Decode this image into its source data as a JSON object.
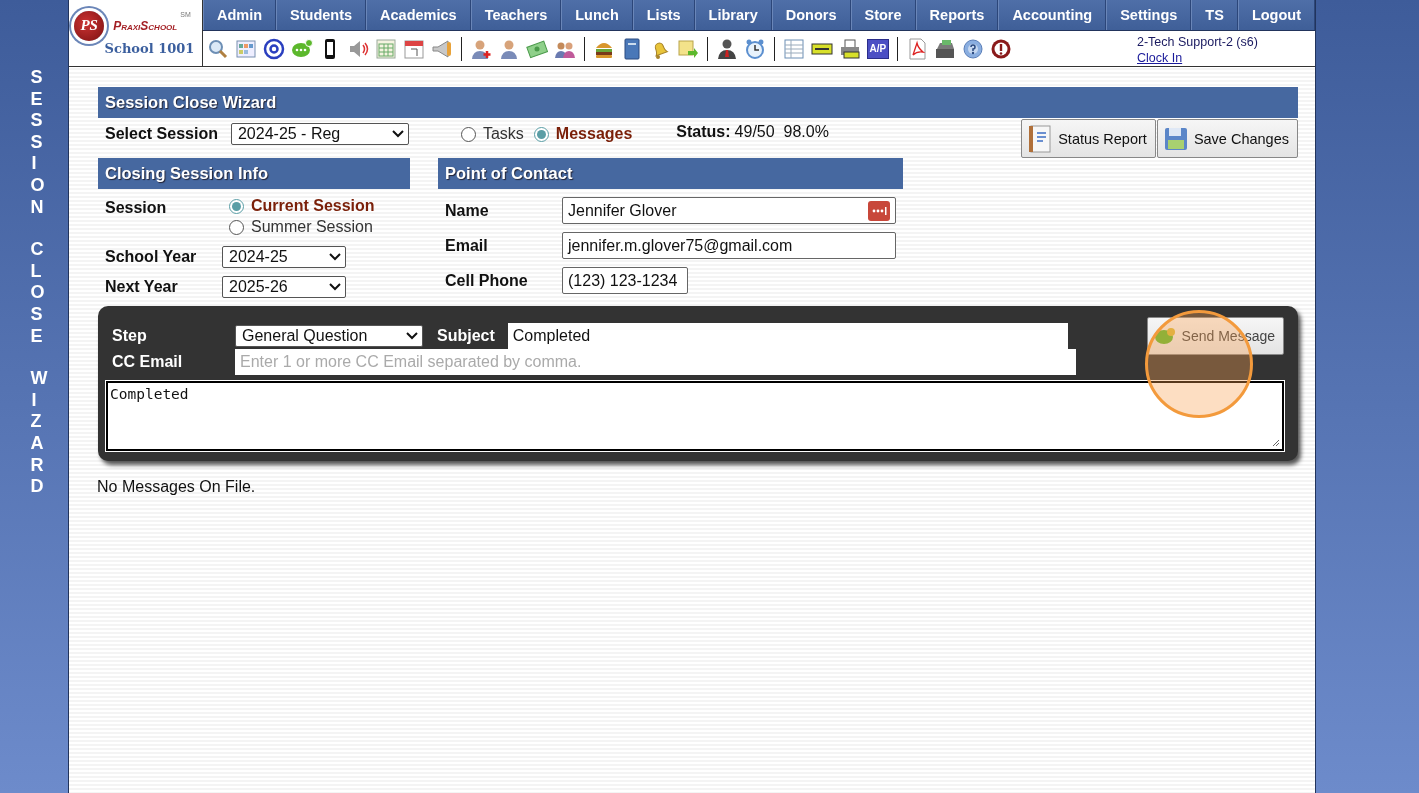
{
  "side_title": [
    "SESSION",
    "CLOSE",
    "WIZARD"
  ],
  "logo": {
    "mark": "PS",
    "brand": "PraxiSchool",
    "tm": "SM",
    "school": "School 1001"
  },
  "nav": [
    "Admin",
    "Students",
    "Academics",
    "Teachers",
    "Lunch",
    "Lists",
    "Library",
    "Donors",
    "Store",
    "Reports",
    "Accounting",
    "Settings",
    "TS",
    "Logout"
  ],
  "toolbar_badge": "A/P",
  "user": {
    "name": "2-Tech Support-2 (s6)",
    "link": "Clock In"
  },
  "wizard": {
    "title": "Session Close Wizard",
    "select_label": "Select Session",
    "select_value": "2024-25 - Reg",
    "views": [
      {
        "label": "Tasks",
        "selected": false
      },
      {
        "label": "Messages",
        "selected": true
      }
    ],
    "status_label": "Status:",
    "status_value": "49/50  98.0%",
    "buttons": [
      {
        "label": "Status Report",
        "kind": "report"
      },
      {
        "label": "Save Changes",
        "kind": "save"
      }
    ]
  },
  "closing_info": {
    "title": "Closing Session Info",
    "session_label": "Session",
    "session_options": [
      {
        "label": "Current Session",
        "selected": true
      },
      {
        "label": "Summer Session",
        "selected": false
      }
    ],
    "fields": [
      {
        "label": "School Year",
        "value": "2024-25"
      },
      {
        "label": "Next Year",
        "value": "2025-26"
      }
    ]
  },
  "contact": {
    "title": "Point of Contact",
    "fields": [
      {
        "label": "Name",
        "value": "Jennifer Glover",
        "kind": "name"
      },
      {
        "label": "Email",
        "value": "jennifer.m.glover75@gmail.com",
        "kind": "email"
      },
      {
        "label": "Cell Phone",
        "value": "(123) 123-1234",
        "kind": "phone"
      }
    ]
  },
  "message": {
    "step_label": "Step",
    "step_value": "General Question",
    "subject_label": "Subject",
    "subject_value": "Completed",
    "cc_label": "CC Email",
    "cc_placeholder": "Enter 1 or more CC Email separated by comma.",
    "body": "Completed",
    "send_label": "Send Message"
  },
  "messages_empty": "No Messages On File."
}
